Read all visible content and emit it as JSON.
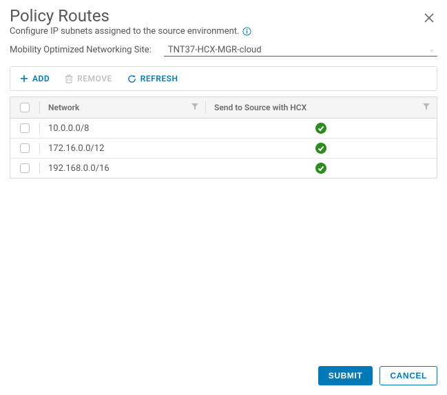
{
  "header": {
    "title": "Policy Routes",
    "subtitle": "Configure IP subnets assigned to the source environment."
  },
  "site": {
    "label": "Mobility Optimized Networking Site:",
    "value": "TNT37-HCX-MGR-cloud"
  },
  "toolbar": {
    "add": "ADD",
    "remove": "REMOVE",
    "refresh": "REFRESH"
  },
  "table": {
    "columns": {
      "network": "Network",
      "send": "Send to Source with HCX"
    },
    "rows": [
      {
        "network": "10.0.0.0/8",
        "send_to_source": true
      },
      {
        "network": "172.16.0.0/12",
        "send_to_source": true
      },
      {
        "network": "192.168.0.0/16",
        "send_to_source": true
      }
    ]
  },
  "footer": {
    "submit": "SUBMIT",
    "cancel": "CANCEL"
  }
}
